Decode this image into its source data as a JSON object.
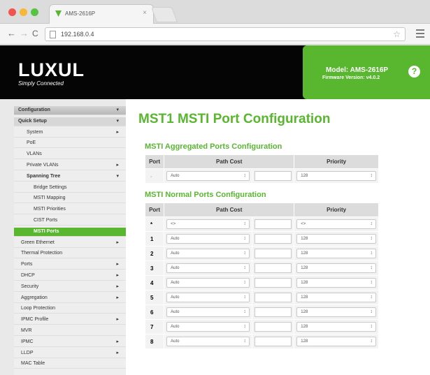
{
  "browser": {
    "tab_title": "AMS-2616P",
    "tab_close": "×",
    "url": "192.168.0.4",
    "star": "☆",
    "back": "←",
    "forward": "→",
    "reload": "C"
  },
  "header": {
    "logo": "LUXUL",
    "tagline": "Simply Connected",
    "model": "Model: AMS-2616P",
    "firmware": "Firmware Version: v4.0.2",
    "help": "?"
  },
  "sidebar": {
    "items": [
      {
        "label": "Configuration",
        "style": "config",
        "arrow": "▾"
      },
      {
        "label": "Quick Setup",
        "style": "quick",
        "arrow": "▾"
      },
      {
        "label": "System",
        "style": "level3",
        "arrow": "▸"
      },
      {
        "label": "PoE",
        "style": "level3",
        "arrow": ""
      },
      {
        "label": "VLANs",
        "style": "level3",
        "arrow": ""
      },
      {
        "label": "Private VLANs",
        "style": "level3",
        "arrow": "▸"
      },
      {
        "label": "Spanning Tree",
        "style": "level3 bold",
        "arrow": "▾"
      },
      {
        "label": "Bridge Settings",
        "style": "level4",
        "arrow": ""
      },
      {
        "label": "MSTI Mapping",
        "style": "level4",
        "arrow": ""
      },
      {
        "label": "MSTI Priorities",
        "style": "level4",
        "arrow": ""
      },
      {
        "label": "CIST Ports",
        "style": "level4",
        "arrow": ""
      },
      {
        "label": "MSTI Ports",
        "style": "active level4",
        "arrow": ""
      },
      {
        "label": "Green Ethernet",
        "style": "level2",
        "arrow": "▸"
      },
      {
        "label": "Thermal Protection",
        "style": "level2",
        "arrow": ""
      },
      {
        "label": "Ports",
        "style": "level2",
        "arrow": "▸"
      },
      {
        "label": "DHCP",
        "style": "level2",
        "arrow": "▸"
      },
      {
        "label": "Security",
        "style": "level2",
        "arrow": "▸"
      },
      {
        "label": "Aggregation",
        "style": "level2",
        "arrow": "▸"
      },
      {
        "label": "Loop Protection",
        "style": "level2",
        "arrow": ""
      },
      {
        "label": "IPMC Profile",
        "style": "level2",
        "arrow": "▸"
      },
      {
        "label": "MVR",
        "style": "level2",
        "arrow": ""
      },
      {
        "label": "IPMC",
        "style": "level2",
        "arrow": "▸"
      },
      {
        "label": "LLDP",
        "style": "level2",
        "arrow": "▸"
      },
      {
        "label": "MAC Table",
        "style": "level2",
        "arrow": ""
      }
    ]
  },
  "main": {
    "title": "MST1 MSTI Port Configuration",
    "aggregated": {
      "title": "MSTI Aggregated Ports Configuration",
      "headers": [
        "Port",
        "Path Cost",
        "Priority"
      ],
      "rows": [
        {
          "port": "-",
          "cost_mode": "Auto",
          "priority": "128"
        }
      ]
    },
    "normal": {
      "title": "MSTI Normal Ports Configuration",
      "headers": [
        "Port",
        "Path Cost",
        "Priority"
      ],
      "rows": [
        {
          "port": "*",
          "cost_mode": "<>",
          "priority": "<>"
        },
        {
          "port": "1",
          "cost_mode": "Auto",
          "priority": "128"
        },
        {
          "port": "2",
          "cost_mode": "Auto",
          "priority": "128"
        },
        {
          "port": "3",
          "cost_mode": "Auto",
          "priority": "128"
        },
        {
          "port": "4",
          "cost_mode": "Auto",
          "priority": "128"
        },
        {
          "port": "5",
          "cost_mode": "Auto",
          "priority": "128"
        },
        {
          "port": "6",
          "cost_mode": "Auto",
          "priority": "128"
        },
        {
          "port": "7",
          "cost_mode": "Auto",
          "priority": "128"
        },
        {
          "port": "8",
          "cost_mode": "Auto",
          "priority": "128"
        }
      ]
    }
  },
  "colors": {
    "accent": "#58b62f",
    "header_bg": "#050505"
  }
}
